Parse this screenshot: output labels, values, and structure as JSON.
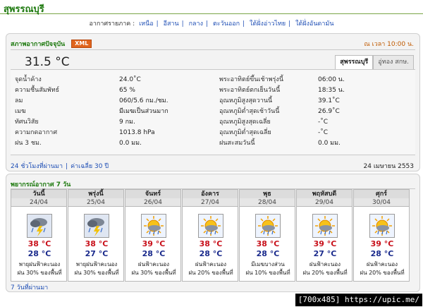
{
  "page_title": "สุพรรณบุรี",
  "region_nav": {
    "label": "อากาศรายภาค :",
    "links": [
      "เหนือ",
      "อีสาน",
      "กลาง",
      "ตะวันออก",
      "ใต้ฝั่งอ่าวไทย",
      "ใต้ฝั่งอันดามัน"
    ]
  },
  "current": {
    "header": "สภาพอากาศปัจจุบัน",
    "xml_badge": "XML",
    "time_label": "ณ  เวลา 10:00 น.",
    "temperature": "31.5 °C",
    "tabs": [
      {
        "label": "สุพรรณบุรี",
        "active": true
      },
      {
        "label": "อู่ทอง สกษ.",
        "active": false
      }
    ],
    "left_obs": [
      {
        "label": "จุดน้ำค้าง",
        "value": "24.0˚C"
      },
      {
        "label": "ความชื้นสัมพัทธ์",
        "value": "65 %"
      },
      {
        "label": "ลม",
        "value": "060/5.6 กม./ชม."
      },
      {
        "label": "เมฆ",
        "value": "มีเมฆเป็นส่วนมาก"
      },
      {
        "label": "ทัศนวิสัย",
        "value": "9 กม."
      },
      {
        "label": "ความกดอากาศ",
        "value": "1013.8 hPa"
      },
      {
        "label": "ฝน 3 ชม.",
        "value": "0.0 มม."
      }
    ],
    "right_obs": [
      {
        "label": "พระอาทิตย์ขึ้นเช้าพรุ่งนี้",
        "value": "06:00 น."
      },
      {
        "label": "พระอาทิตย์ตกเย็นวันนี้",
        "value": "18:35 น."
      },
      {
        "label": "อุณหภูมิสูงสุดวานนี้",
        "value": "39.1˚C"
      },
      {
        "label": "อุณหภูมิต่ำสุดเช้าวันนี้",
        "value": "26.9˚C"
      },
      {
        "label": "อุณหภูมิสูงสุดเฉลี่ย",
        "value": "-˚C"
      },
      {
        "label": "อุณหภูมิต่ำสุดเฉลี่ย",
        "value": "-˚C"
      },
      {
        "label": "ฝนสะสมวันนี้",
        "value": "0.0 มม."
      }
    ],
    "footer_links": [
      "24 ชั่วโมงที่ผ่านมา",
      "ค่าเฉลี่ย 30 ปี"
    ],
    "footer_date": "24 เมษายน 2553"
  },
  "forecast": {
    "header": "พยากรณ์อากาศ 7 วัน",
    "days": [
      {
        "day": "วันนี้",
        "date": "24/04",
        "icon": "thunderstorm-icon",
        "max": "38 °C",
        "min": "28 °C",
        "cond": "พายุฝนฟ้าคะนอง",
        "rain": "ฝน 30% ของพื้นที่"
      },
      {
        "day": "พรุ่งนี้",
        "date": "25/04",
        "icon": "thunderstorm-icon",
        "max": "38 °C",
        "min": "27 °C",
        "cond": "พายุฝนฟ้าคะนอง",
        "rain": "ฝน 30% ของพื้นที่"
      },
      {
        "day": "จันทร์",
        "date": "26/04",
        "icon": "sun-rain-icon",
        "max": "39 °C",
        "min": "28 °C",
        "cond": "ฝนฟ้าคะนอง",
        "rain": "ฝน 30% ของพื้นที่"
      },
      {
        "day": "อังคาร",
        "date": "27/04",
        "icon": "sun-rain-icon",
        "max": "38 °C",
        "min": "28 °C",
        "cond": "ฝนฟ้าคะนอง",
        "rain": "ฝน 20% ของพื้นที่"
      },
      {
        "day": "พุธ",
        "date": "28/04",
        "icon": "sun-rain-icon",
        "max": "38 °C",
        "min": "28 °C",
        "cond": "มีเมฆบางส่วน",
        "rain": "ฝน 10% ของพื้นที่"
      },
      {
        "day": "พฤหัสบดี",
        "date": "29/04",
        "icon": "sun-rain-icon",
        "max": "39 °C",
        "min": "27 °C",
        "cond": "ฝนฟ้าคะนอง",
        "rain": "ฝน 20% ของพื้นที่"
      },
      {
        "day": "ศุกร์",
        "date": "30/04",
        "icon": "sun-rain-icon",
        "max": "39 °C",
        "min": "28 °C",
        "cond": "ฝนฟ้าคะนอง",
        "rain": "ฝน 20% ของพื้นที่"
      }
    ],
    "footer_link": "7 วันที่ผ่านมา"
  },
  "watermark": "[700x485] https://upic.me/",
  "colors": {
    "accent_green": "#1f7a10",
    "link_blue": "#1f4fb5",
    "max_red": "#c8101a",
    "min_blue": "#1a2a8c",
    "xml_orange": "#e0641d"
  }
}
